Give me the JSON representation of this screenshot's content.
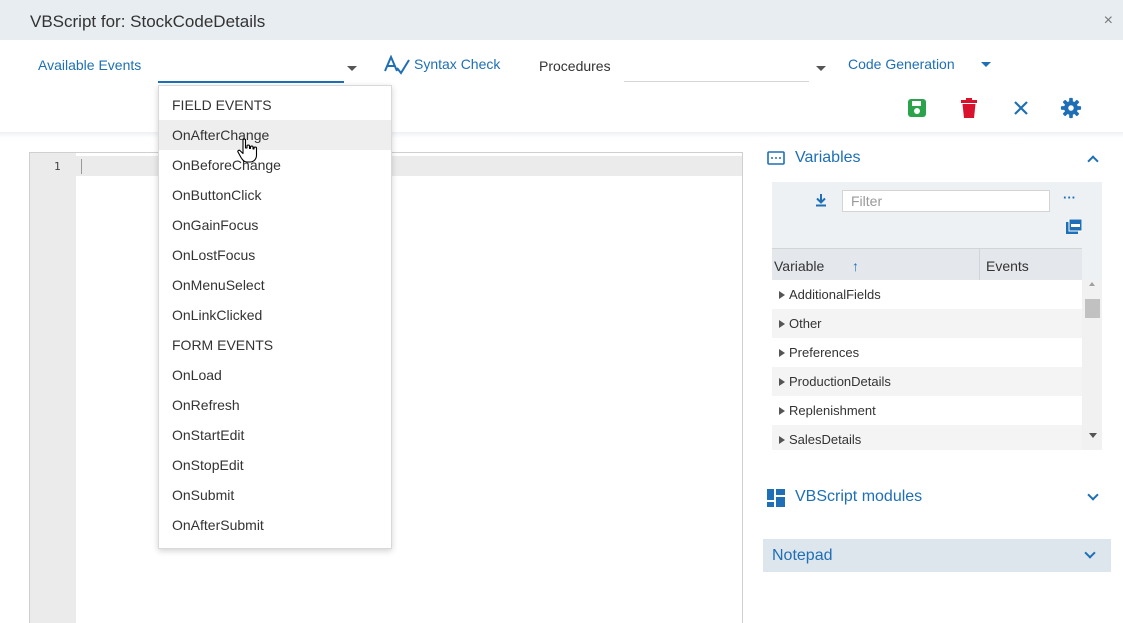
{
  "window": {
    "title": "VBScript for: StockCodeDetails",
    "close_glyph": "×"
  },
  "toolbar": {
    "available_events_label": "Available Events",
    "syntax_check_label": "Syntax Check",
    "procedures_label": "Procedures",
    "code_generation_label": "Code Generation"
  },
  "actions": {
    "save_color": "#2aa34a",
    "delete_color": "#d9122d",
    "cancel_color": "#1e6fb5",
    "settings_color": "#1e6fb5"
  },
  "editor": {
    "line_number": "1"
  },
  "events_dropdown": {
    "items": [
      "FIELD EVENTS",
      "OnAfterChange",
      "OnBeforeChange",
      "OnButtonClick",
      "OnGainFocus",
      "OnLostFocus",
      "OnMenuSelect",
      "OnLinkClicked",
      "FORM EVENTS",
      "OnLoad",
      "OnRefresh",
      "OnStartEdit",
      "OnStopEdit",
      "OnSubmit",
      "OnAfterSubmit"
    ]
  },
  "variables_panel": {
    "title": "Variables",
    "filter_placeholder": "Filter",
    "more_glyph": "···",
    "columns": {
      "variable": "Variable",
      "sort_glyph": "↑",
      "events": "Events"
    },
    "rows": [
      "AdditionalFields",
      "Other",
      "Preferences",
      "ProductionDetails",
      "Replenishment",
      "SalesDetails"
    ]
  },
  "modules_panel": {
    "title": "VBScript modules"
  },
  "notepad_panel": {
    "title": "Notepad"
  },
  "colors": {
    "accent": "#1e6fb5",
    "header_bg": "#e8edf1"
  }
}
